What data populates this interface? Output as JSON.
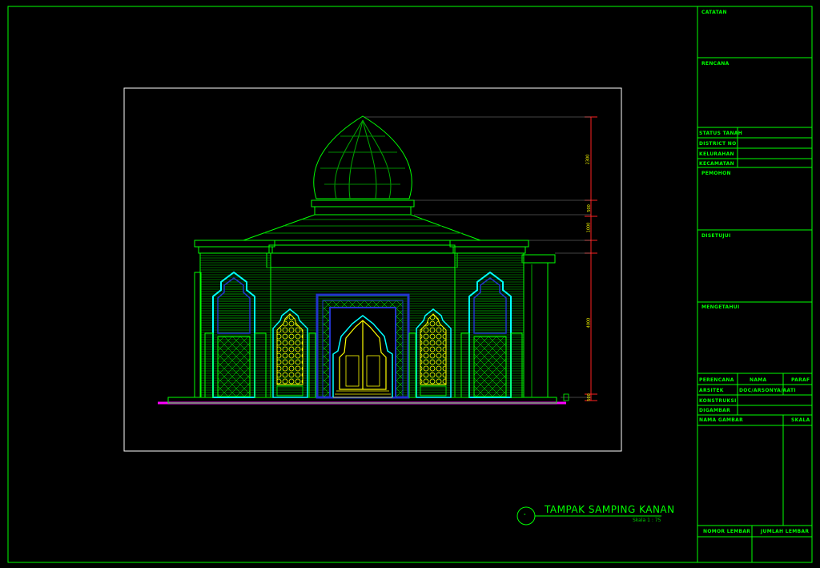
{
  "drawing": {
    "title": "TAMPAK SAMPING KANAN",
    "scale": "Skala 1 : 75",
    "symbol": "-"
  },
  "dimensions": [
    "2300",
    "500",
    "1000",
    "4000",
    "500"
  ],
  "title_block": {
    "catatan": "CATATAN",
    "rencana": "RENCANA",
    "status_tanah": "STATUS TANAH",
    "district": "DISTRICT NO",
    "kelurahan": "KELURAHAN",
    "kecamatan": "KECAMATAN",
    "pemohon": "PEMOHON",
    "disetujui": "DISETUJUI",
    "mengetahui": "MENGETAHUI",
    "perencana": "PERENCANA",
    "nama": "NAMA",
    "paraf": "PARAF",
    "arsitek": "ARSITEK",
    "arsitek_name": "DOC/ARSONYA/AATI",
    "konstruksi": "KONSTRUKSI",
    "digambar": "DIGAMBAR",
    "nama_gambar": "NAMA GAMBAR",
    "skala": "SKALA",
    "nomor_lembar": "NOMOR LEMBAR",
    "jumlah_lembar": "JUMLAH LEMBAR"
  },
  "colors": {
    "frame": "#00ff00",
    "viewport": "#ffffff",
    "cyan": "#00ffff",
    "yellow": "#ffff00",
    "blue": "#2233cc",
    "magenta": "#ff00ff",
    "dim_red": "#ff2222"
  }
}
